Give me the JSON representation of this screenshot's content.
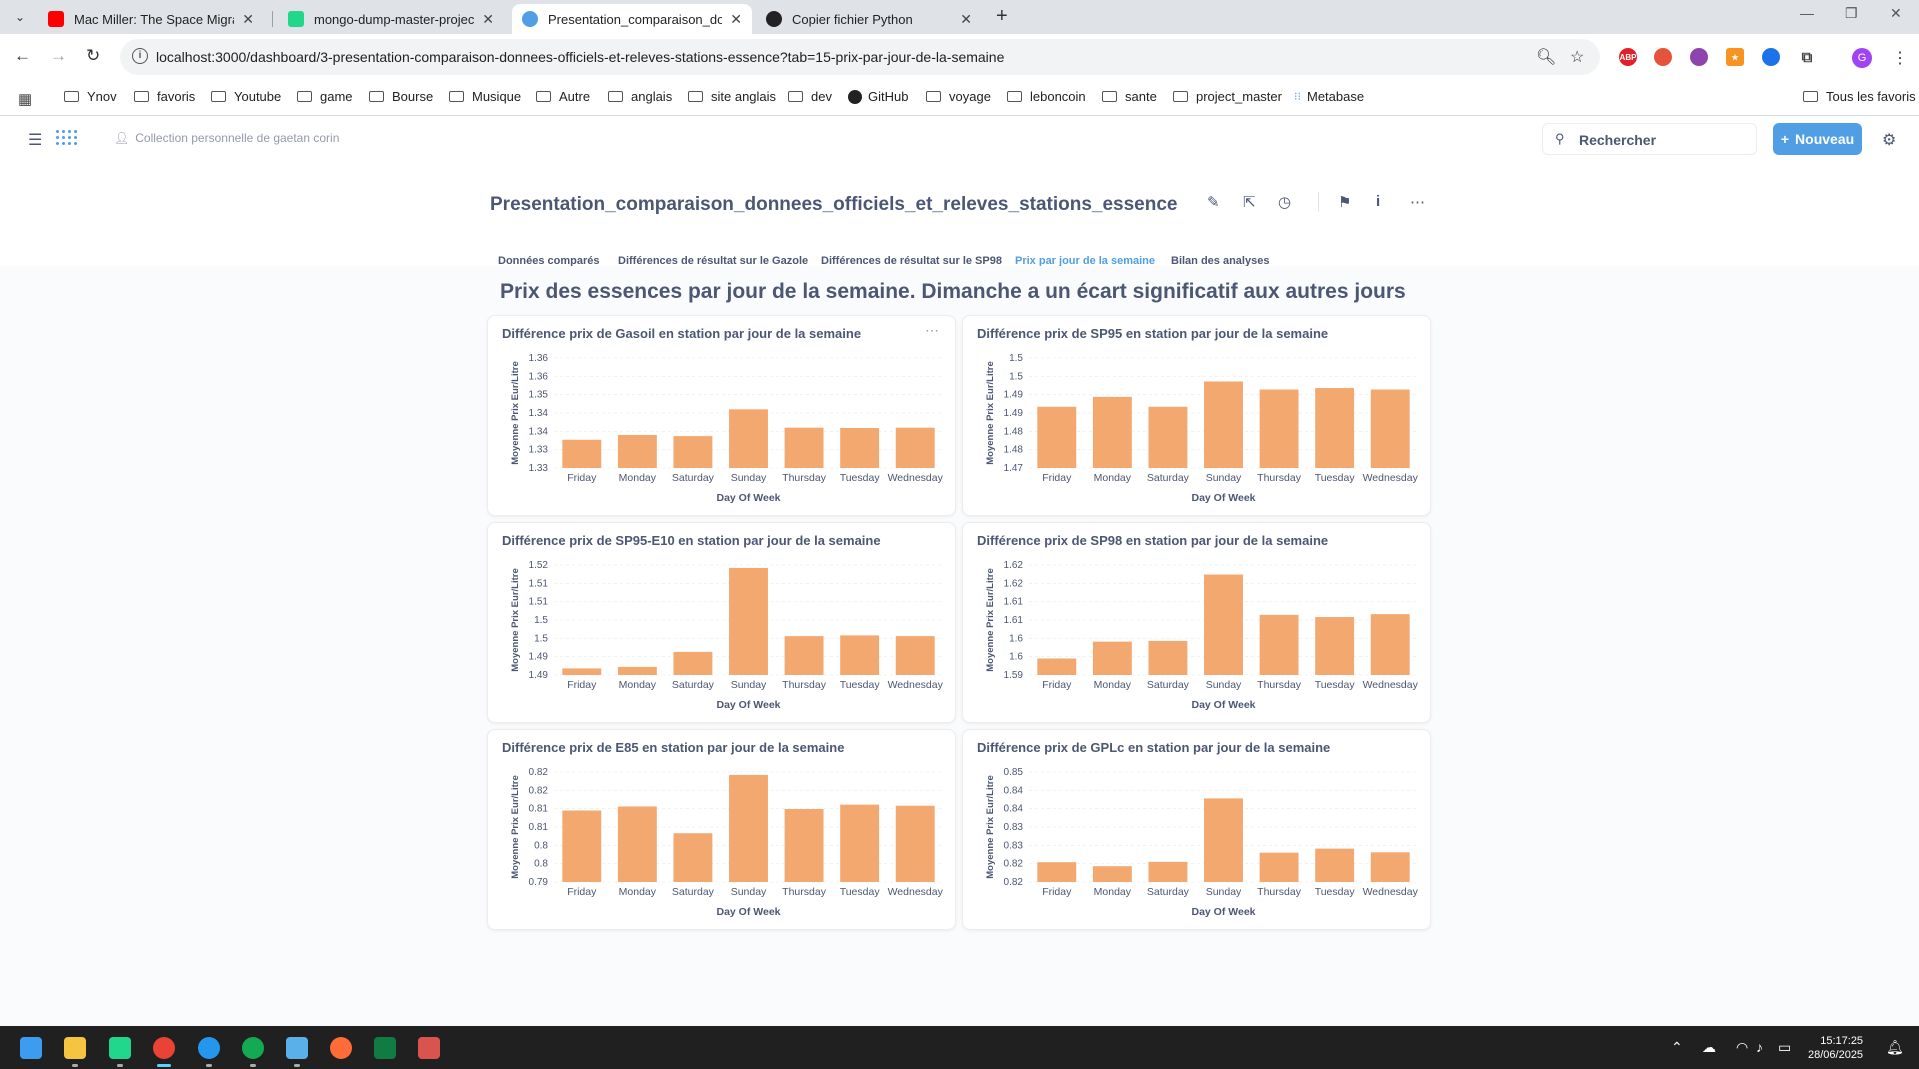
{
  "browser": {
    "tabs": [
      {
        "title": "Mac Miller: The Space Migration",
        "active": false,
        "favicon_color": "#ff0000"
      },
      {
        "title": "mongo-dump-master-project -",
        "active": false,
        "favicon_color": "#21d789"
      },
      {
        "title": "Presentation_comparaison_don",
        "active": true,
        "favicon_color": "#509ee3"
      },
      {
        "title": "Copier fichier Python",
        "active": false,
        "favicon_color": "#222222"
      }
    ],
    "url": "localhost:3000/dashboard/3-presentation-comparaison-donnees-officiels-et-releves-stations-essence?tab=15-prix-par-jour-de-la-semaine",
    "profile_initial": "G",
    "extensions": [
      {
        "name": "adblock-icon",
        "label": "ABP",
        "color": "#e0202b"
      },
      {
        "name": "extension-red-icon",
        "label": "",
        "color": "#e5533d"
      },
      {
        "name": "extension-purple-icon",
        "label": "",
        "color": "#8e44ad"
      },
      {
        "name": "extension-star-icon",
        "label": "★",
        "color": "#f7931e"
      },
      {
        "name": "extension-blue-icon",
        "label": "",
        "color": "#1a73e8"
      }
    ],
    "bookmarks": [
      "Ynov",
      "favoris",
      "Youtube",
      "game",
      "Bourse",
      "Musique",
      "Autre",
      "anglais",
      "site anglais",
      "dev",
      "GitHub",
      "voyage",
      "leboncoin",
      "sante",
      "project_master",
      "Metabase"
    ],
    "all_bookmarks": "Tous les favoris"
  },
  "app": {
    "collection": "Collection personnelle de gaetan corin",
    "search_placeholder": "Rechercher",
    "new_label": "Nouveau",
    "dashboard_title": "Presentation_comparaison_donnees_officiels_et_releves_stations_essence",
    "tabs": [
      "Données comparés",
      "Différences de résultat sur le Gazole",
      "Différences de résultat sur le SP98",
      "Prix par jour de la semaine",
      "Bilan des analyses"
    ],
    "active_tab": 3,
    "section_heading": "Prix des essences par jour de la semaine. Dimanche a un écart significatif aux autres jours",
    "bar_color": "#f2a86f"
  },
  "chart_data": [
    {
      "type": "bar",
      "title": "Différence prix de Gasoil en station par jour de la semaine",
      "xlabel": "Day Of Week",
      "ylabel": "Moyenne Prix Eur/Litre",
      "categories": [
        "Friday",
        "Monday",
        "Saturday",
        "Sunday",
        "Thursday",
        "Tuesday",
        "Wednesday"
      ],
      "values": [
        1.3377,
        1.339,
        1.3387,
        1.346,
        1.341,
        1.3409,
        1.341
      ],
      "ylim": [
        1.33,
        1.36
      ],
      "yticks": [
        1.33,
        1.335,
        1.34,
        1.345,
        1.35,
        1.355,
        1.36
      ],
      "ytick_labels": [
        "1.33",
        "1.33",
        "1.34",
        "1.34",
        "1.35",
        "1.36",
        "1.36"
      ]
    },
    {
      "type": "bar",
      "title": "Différence prix de SP95 en station par jour de la semaine",
      "xlabel": "Day Of Week",
      "ylabel": "Moyenne Prix Eur/Litre",
      "categories": [
        "Friday",
        "Monday",
        "Saturday",
        "Sunday",
        "Thursday",
        "Tuesday",
        "Wednesday"
      ],
      "values": [
        1.4867,
        1.4894,
        1.4867,
        1.4936,
        1.4914,
        1.4918,
        1.4914
      ],
      "ylim": [
        1.47,
        1.5
      ],
      "yticks": [
        1.47,
        1.475,
        1.48,
        1.485,
        1.49,
        1.495,
        1.5
      ],
      "ytick_labels": [
        "1.47",
        "1.48",
        "1.48",
        "1.49",
        "1.49",
        "1.5",
        "1.5"
      ]
    },
    {
      "type": "bar",
      "title": "Différence prix de SP95-E10 en station par jour de la semaine",
      "xlabel": "Day Of Week",
      "ylabel": "Moyenne Prix Eur/Litre",
      "categories": [
        "Friday",
        "Monday",
        "Saturday",
        "Sunday",
        "Thursday",
        "Tuesday",
        "Wednesday"
      ],
      "values": [
        1.4868,
        1.4872,
        1.4913,
        1.5142,
        1.4956,
        1.4958,
        1.4956
      ],
      "ylim": [
        1.485,
        1.515
      ],
      "yticks": [
        1.485,
        1.49,
        1.495,
        1.5,
        1.505,
        1.51,
        1.515
      ],
      "ytick_labels": [
        "1.49",
        "1.49",
        "1.5",
        "1.5",
        "1.51",
        "1.51",
        "1.52"
      ]
    },
    {
      "type": "bar",
      "title": "Différence prix de SP98 en station par jour de la semaine",
      "xlabel": "Day Of Week",
      "ylabel": "Moyenne Prix Eur/Litre",
      "categories": [
        "Friday",
        "Monday",
        "Saturday",
        "Sunday",
        "Thursday",
        "Tuesday",
        "Wednesday"
      ],
      "values": [
        1.5895,
        1.5941,
        1.5943,
        1.6124,
        1.6014,
        1.6008,
        1.6016
      ],
      "ylim": [
        1.585,
        1.615
      ],
      "yticks": [
        1.585,
        1.59,
        1.595,
        1.6,
        1.605,
        1.61,
        1.615
      ],
      "ytick_labels": [
        "1.59",
        "1.6",
        "1.6",
        "1.61",
        "1.61",
        "1.62",
        "1.62"
      ]
    },
    {
      "type": "bar",
      "title": "Différence prix de E85 en station par jour de la semaine",
      "xlabel": "Day Of Week",
      "ylabel": "Moyenne Prix Eur/Litre",
      "categories": [
        "Friday",
        "Monday",
        "Saturday",
        "Sunday",
        "Thursday",
        "Tuesday",
        "Wednesday"
      ],
      "values": [
        0.8095,
        0.8106,
        0.8033,
        0.8192,
        0.8099,
        0.8111,
        0.8108
      ],
      "ylim": [
        0.79,
        0.82
      ],
      "yticks": [
        0.79,
        0.795,
        0.8,
        0.805,
        0.81,
        0.815,
        0.82
      ],
      "ytick_labels": [
        "0.79",
        "0.8",
        "0.8",
        "0.81",
        "0.81",
        "0.82",
        "0.82"
      ]
    },
    {
      "type": "bar",
      "title": "Différence prix de GPLc en station par jour de la semaine",
      "xlabel": "Day Of Week",
      "ylabel": "Moyenne Prix Eur/Litre",
      "categories": [
        "Friday",
        "Monday",
        "Saturday",
        "Sunday",
        "Thursday",
        "Tuesday",
        "Wednesday"
      ],
      "values": [
        0.8204,
        0.8193,
        0.8205,
        0.8378,
        0.823,
        0.8241,
        0.8231
      ],
      "ylim": [
        0.815,
        0.845
      ],
      "yticks": [
        0.815,
        0.82,
        0.825,
        0.83,
        0.835,
        0.84,
        0.845
      ],
      "ytick_labels": [
        "0.82",
        "0.82",
        "0.83",
        "0.83",
        "0.84",
        "0.84",
        "0.85"
      ]
    }
  ],
  "taskbar": {
    "time": "15:17:25",
    "date": "28/06/2025",
    "apps": [
      {
        "name": "windows-start-icon",
        "color": "#3b9cf0"
      },
      {
        "name": "file-explorer-icon",
        "color": "#f5c542"
      },
      {
        "name": "pycharm-icon",
        "color": "#21d789"
      },
      {
        "name": "chrome-icon",
        "color": "#ea4335"
      },
      {
        "name": "docker-icon",
        "color": "#2496ed"
      },
      {
        "name": "mongodb-icon",
        "color": "#13aa52"
      },
      {
        "name": "notepad-icon",
        "color": "#5ab0e8"
      },
      {
        "name": "postman-icon",
        "color": "#ff6c37"
      },
      {
        "name": "excel-icon",
        "color": "#107c41"
      },
      {
        "name": "calendar-app-icon",
        "color": "#d9534f"
      }
    ]
  }
}
